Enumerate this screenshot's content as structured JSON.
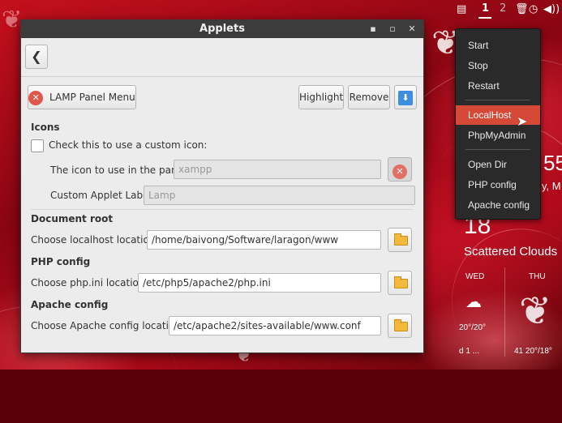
{
  "panel": {
    "workspace_1": "1",
    "workspace_2": "2",
    "icons": [
      "monitor-icon",
      "trash-icon",
      "clock-icon",
      "volume-icon"
    ]
  },
  "menu": {
    "items": [
      "Start",
      "Stop",
      "Restart",
      "LocalHost",
      "PhpMyAdmin",
      "Open Dir",
      "PHP config",
      "Apache config"
    ],
    "selected": "LocalHost",
    "selected_color": "#d64937"
  },
  "desklet": {
    "time_fragment": "55",
    "date_fragment": "y, M",
    "temp_big": "18",
    "condition": "Scattered Clouds",
    "day1": "WED",
    "day1_temp": "20°/20°",
    "day2": "THU",
    "day2_bottom": "41 20°/18°",
    "day3_bottom": "d 1 ..."
  },
  "window": {
    "title": "Applets",
    "minimize_label": "▪",
    "maximize_label": "▫",
    "close_label": "✕",
    "back_label": "❮",
    "applet_menu_button": "LAMP Panel Menu",
    "highlight_button": "Highlight",
    "remove_button": "Remove",
    "icons_section": "Icons",
    "custom_icon_checkbox_label": "Check this to use a custom icon:",
    "panel_icon_label": "The icon to use in the panel:",
    "panel_icon_value": "xampp",
    "custom_label_label": "Custom Applet Label:",
    "custom_label_value": "Lamp",
    "docroot_section": "Document root",
    "docroot_label": "Choose localhost location:",
    "docroot_value": "/home/baivong/Software/laragon/www",
    "php_section": "PHP config",
    "php_label": "Choose php.ini location:",
    "php_value": "/etc/php5/apache2/php.ini",
    "apache_section": "Apache config",
    "apache_label": "Choose Apache config location:",
    "apache_value": "/etc/apache2/sites-available/www.conf",
    "accent": "#3d8ee0"
  }
}
